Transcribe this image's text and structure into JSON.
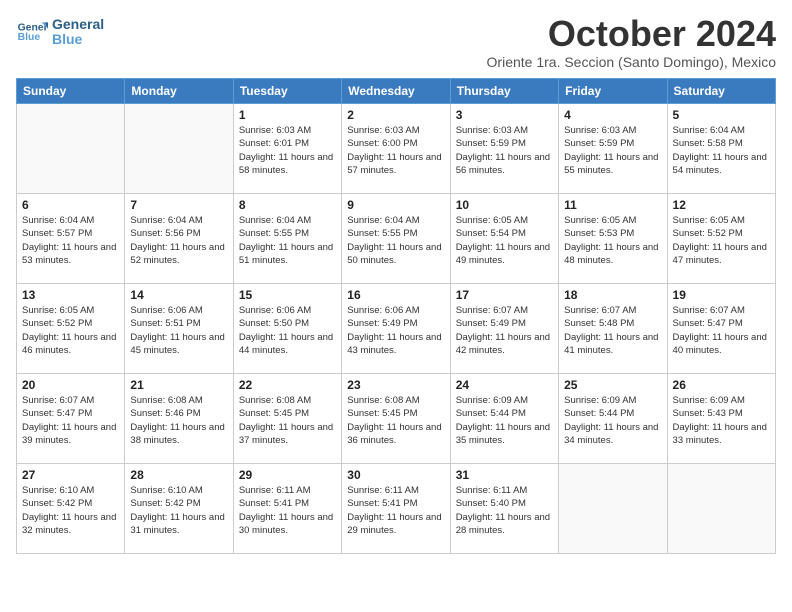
{
  "logo": {
    "line1": "General",
    "line2": "Blue"
  },
  "title": "October 2024",
  "subtitle": "Oriente 1ra. Seccion (Santo Domingo), Mexico",
  "headers": [
    "Sunday",
    "Monday",
    "Tuesday",
    "Wednesday",
    "Thursday",
    "Friday",
    "Saturday"
  ],
  "weeks": [
    [
      {
        "day": "",
        "info": ""
      },
      {
        "day": "",
        "info": ""
      },
      {
        "day": "1",
        "info": "Sunrise: 6:03 AM\nSunset: 6:01 PM\nDaylight: 11 hours and 58 minutes."
      },
      {
        "day": "2",
        "info": "Sunrise: 6:03 AM\nSunset: 6:00 PM\nDaylight: 11 hours and 57 minutes."
      },
      {
        "day": "3",
        "info": "Sunrise: 6:03 AM\nSunset: 5:59 PM\nDaylight: 11 hours and 56 minutes."
      },
      {
        "day": "4",
        "info": "Sunrise: 6:03 AM\nSunset: 5:59 PM\nDaylight: 11 hours and 55 minutes."
      },
      {
        "day": "5",
        "info": "Sunrise: 6:04 AM\nSunset: 5:58 PM\nDaylight: 11 hours and 54 minutes."
      }
    ],
    [
      {
        "day": "6",
        "info": "Sunrise: 6:04 AM\nSunset: 5:57 PM\nDaylight: 11 hours and 53 minutes."
      },
      {
        "day": "7",
        "info": "Sunrise: 6:04 AM\nSunset: 5:56 PM\nDaylight: 11 hours and 52 minutes."
      },
      {
        "day": "8",
        "info": "Sunrise: 6:04 AM\nSunset: 5:55 PM\nDaylight: 11 hours and 51 minutes."
      },
      {
        "day": "9",
        "info": "Sunrise: 6:04 AM\nSunset: 5:55 PM\nDaylight: 11 hours and 50 minutes."
      },
      {
        "day": "10",
        "info": "Sunrise: 6:05 AM\nSunset: 5:54 PM\nDaylight: 11 hours and 49 minutes."
      },
      {
        "day": "11",
        "info": "Sunrise: 6:05 AM\nSunset: 5:53 PM\nDaylight: 11 hours and 48 minutes."
      },
      {
        "day": "12",
        "info": "Sunrise: 6:05 AM\nSunset: 5:52 PM\nDaylight: 11 hours and 47 minutes."
      }
    ],
    [
      {
        "day": "13",
        "info": "Sunrise: 6:05 AM\nSunset: 5:52 PM\nDaylight: 11 hours and 46 minutes."
      },
      {
        "day": "14",
        "info": "Sunrise: 6:06 AM\nSunset: 5:51 PM\nDaylight: 11 hours and 45 minutes."
      },
      {
        "day": "15",
        "info": "Sunrise: 6:06 AM\nSunset: 5:50 PM\nDaylight: 11 hours and 44 minutes."
      },
      {
        "day": "16",
        "info": "Sunrise: 6:06 AM\nSunset: 5:49 PM\nDaylight: 11 hours and 43 minutes."
      },
      {
        "day": "17",
        "info": "Sunrise: 6:07 AM\nSunset: 5:49 PM\nDaylight: 11 hours and 42 minutes."
      },
      {
        "day": "18",
        "info": "Sunrise: 6:07 AM\nSunset: 5:48 PM\nDaylight: 11 hours and 41 minutes."
      },
      {
        "day": "19",
        "info": "Sunrise: 6:07 AM\nSunset: 5:47 PM\nDaylight: 11 hours and 40 minutes."
      }
    ],
    [
      {
        "day": "20",
        "info": "Sunrise: 6:07 AM\nSunset: 5:47 PM\nDaylight: 11 hours and 39 minutes."
      },
      {
        "day": "21",
        "info": "Sunrise: 6:08 AM\nSunset: 5:46 PM\nDaylight: 11 hours and 38 minutes."
      },
      {
        "day": "22",
        "info": "Sunrise: 6:08 AM\nSunset: 5:45 PM\nDaylight: 11 hours and 37 minutes."
      },
      {
        "day": "23",
        "info": "Sunrise: 6:08 AM\nSunset: 5:45 PM\nDaylight: 11 hours and 36 minutes."
      },
      {
        "day": "24",
        "info": "Sunrise: 6:09 AM\nSunset: 5:44 PM\nDaylight: 11 hours and 35 minutes."
      },
      {
        "day": "25",
        "info": "Sunrise: 6:09 AM\nSunset: 5:44 PM\nDaylight: 11 hours and 34 minutes."
      },
      {
        "day": "26",
        "info": "Sunrise: 6:09 AM\nSunset: 5:43 PM\nDaylight: 11 hours and 33 minutes."
      }
    ],
    [
      {
        "day": "27",
        "info": "Sunrise: 6:10 AM\nSunset: 5:42 PM\nDaylight: 11 hours and 32 minutes."
      },
      {
        "day": "28",
        "info": "Sunrise: 6:10 AM\nSunset: 5:42 PM\nDaylight: 11 hours and 31 minutes."
      },
      {
        "day": "29",
        "info": "Sunrise: 6:11 AM\nSunset: 5:41 PM\nDaylight: 11 hours and 30 minutes."
      },
      {
        "day": "30",
        "info": "Sunrise: 6:11 AM\nSunset: 5:41 PM\nDaylight: 11 hours and 29 minutes."
      },
      {
        "day": "31",
        "info": "Sunrise: 6:11 AM\nSunset: 5:40 PM\nDaylight: 11 hours and 28 minutes."
      },
      {
        "day": "",
        "info": ""
      },
      {
        "day": "",
        "info": ""
      }
    ]
  ]
}
